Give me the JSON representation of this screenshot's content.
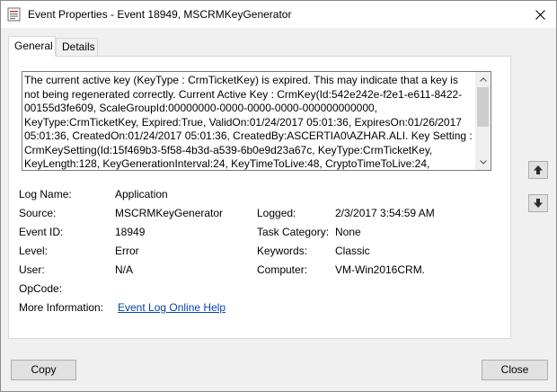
{
  "window": {
    "title": "Event Properties - Event 18949, MSCRMKeyGenerator"
  },
  "tabs": [
    {
      "label": "General",
      "active": true
    },
    {
      "label": "Details",
      "active": false
    }
  ],
  "description": "The current active key (KeyType : CrmTicketKey) is expired.  This may indicate that a key is not being regenerated correctly.  Current Active Key : CrmKey(Id:542e242e-f2e1-e611-8422-00155d3fe609, ScaleGroupId:00000000-0000-0000-0000-000000000000, KeyType:CrmTicketKey, Expired:True, ValidOn:01/24/2017 05:01:36, ExpiresOn:01/26/2017 05:01:36, CreatedOn:01/24/2017 05:01:36, CreatedBy:ASCERTIA0\\AZHAR.ALI.  Key Setting : CrmKeySetting(Id:15f469b3-5f58-4b3d-a539-6b0e9d23a67c, KeyType:CrmTicketKey, KeyLength:128, KeyGenerationInterval:24, KeyTimeToLive:48, CryptoTimeToLive:24,",
  "fields": {
    "log_name": {
      "label": "Log Name:",
      "value": "Application"
    },
    "source": {
      "label": "Source:",
      "value": "MSCRMKeyGenerator"
    },
    "logged": {
      "label": "Logged:",
      "value": "2/3/2017 3:54:59 AM"
    },
    "event_id": {
      "label": "Event ID:",
      "value": "18949"
    },
    "task_category": {
      "label": "Task Category:",
      "value": "None"
    },
    "level": {
      "label": "Level:",
      "value": "Error"
    },
    "keywords": {
      "label": "Keywords:",
      "value": "Classic"
    },
    "user": {
      "label": "User:",
      "value": "N/A"
    },
    "computer": {
      "label": "Computer:",
      "value": "VM-Win2016CRM."
    },
    "opcode": {
      "label": "OpCode:",
      "value": ""
    },
    "more_info": {
      "label": "More Information:",
      "link": "Event Log Online Help"
    }
  },
  "buttons": {
    "copy": "Copy",
    "close": "Close"
  },
  "icons": {
    "window": "event-viewer-icon",
    "close": "close-icon",
    "prev": "arrow-up-icon",
    "next": "arrow-down-icon"
  }
}
